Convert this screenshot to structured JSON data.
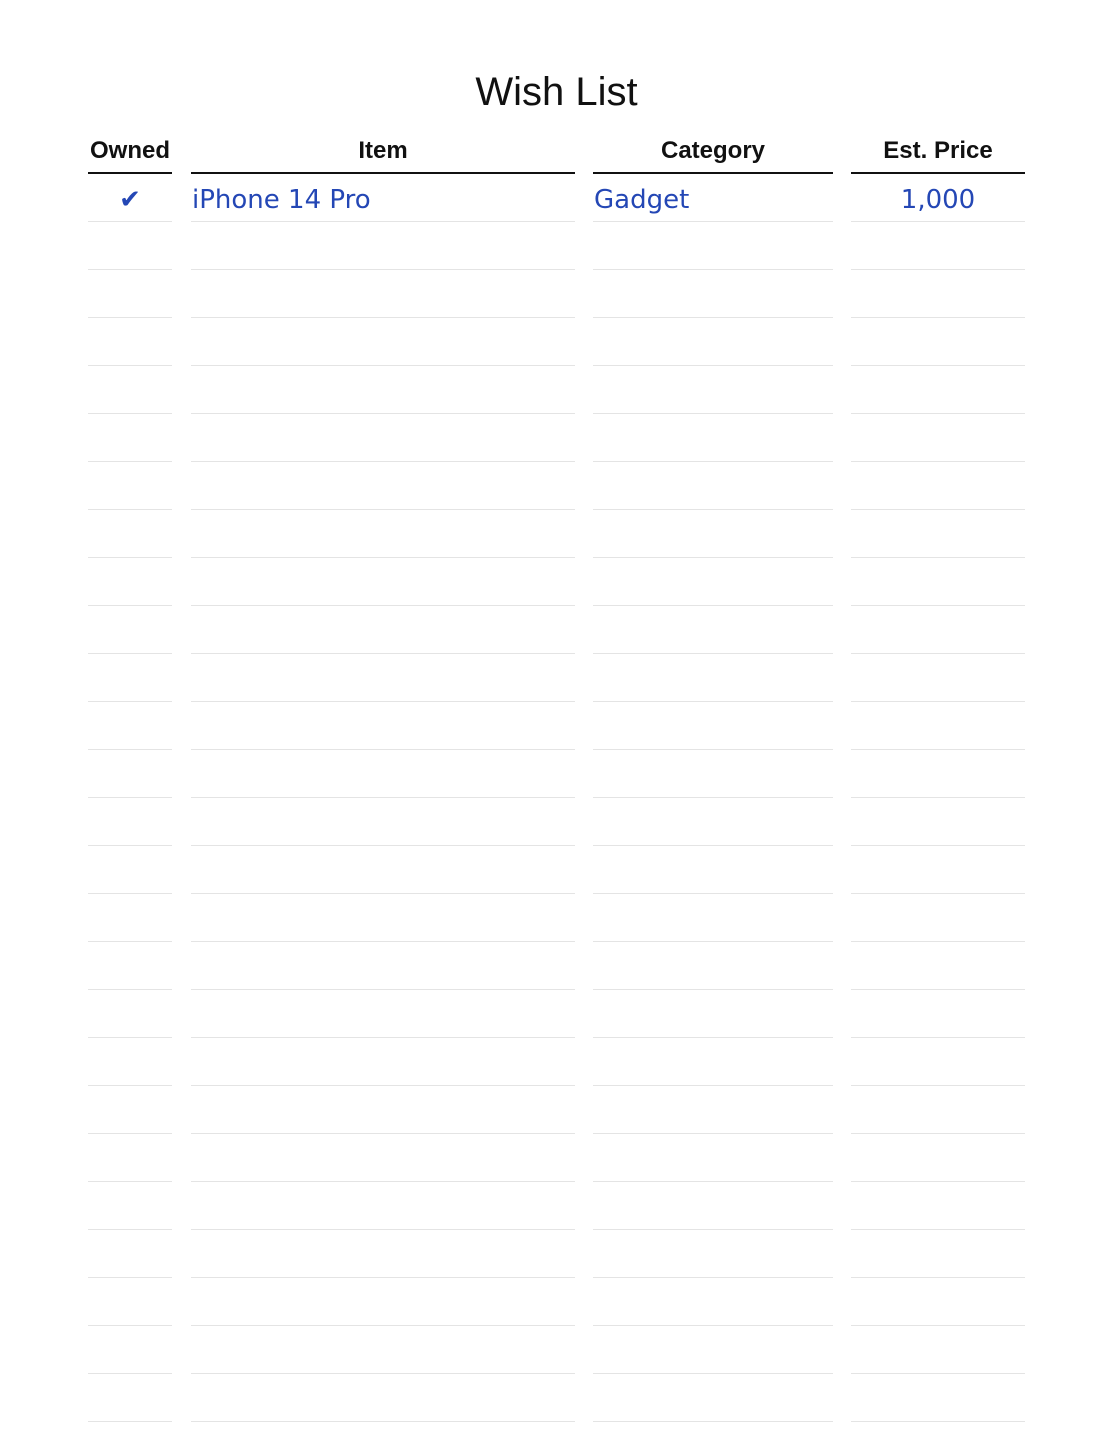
{
  "page": {
    "title": "Wish List"
  },
  "table": {
    "headers": {
      "owned": "Owned",
      "item": "Item",
      "category": "Category",
      "price": "Est. Price"
    },
    "rows": [
      {
        "owned": "✔",
        "item": "iPhone 14 Pro",
        "category": "Gadget",
        "price": "1,000"
      }
    ],
    "empty_row_count": 25
  },
  "colors": {
    "ink": "#2447b5",
    "rule": "#e4e4e4",
    "header_rule": "#111111"
  }
}
